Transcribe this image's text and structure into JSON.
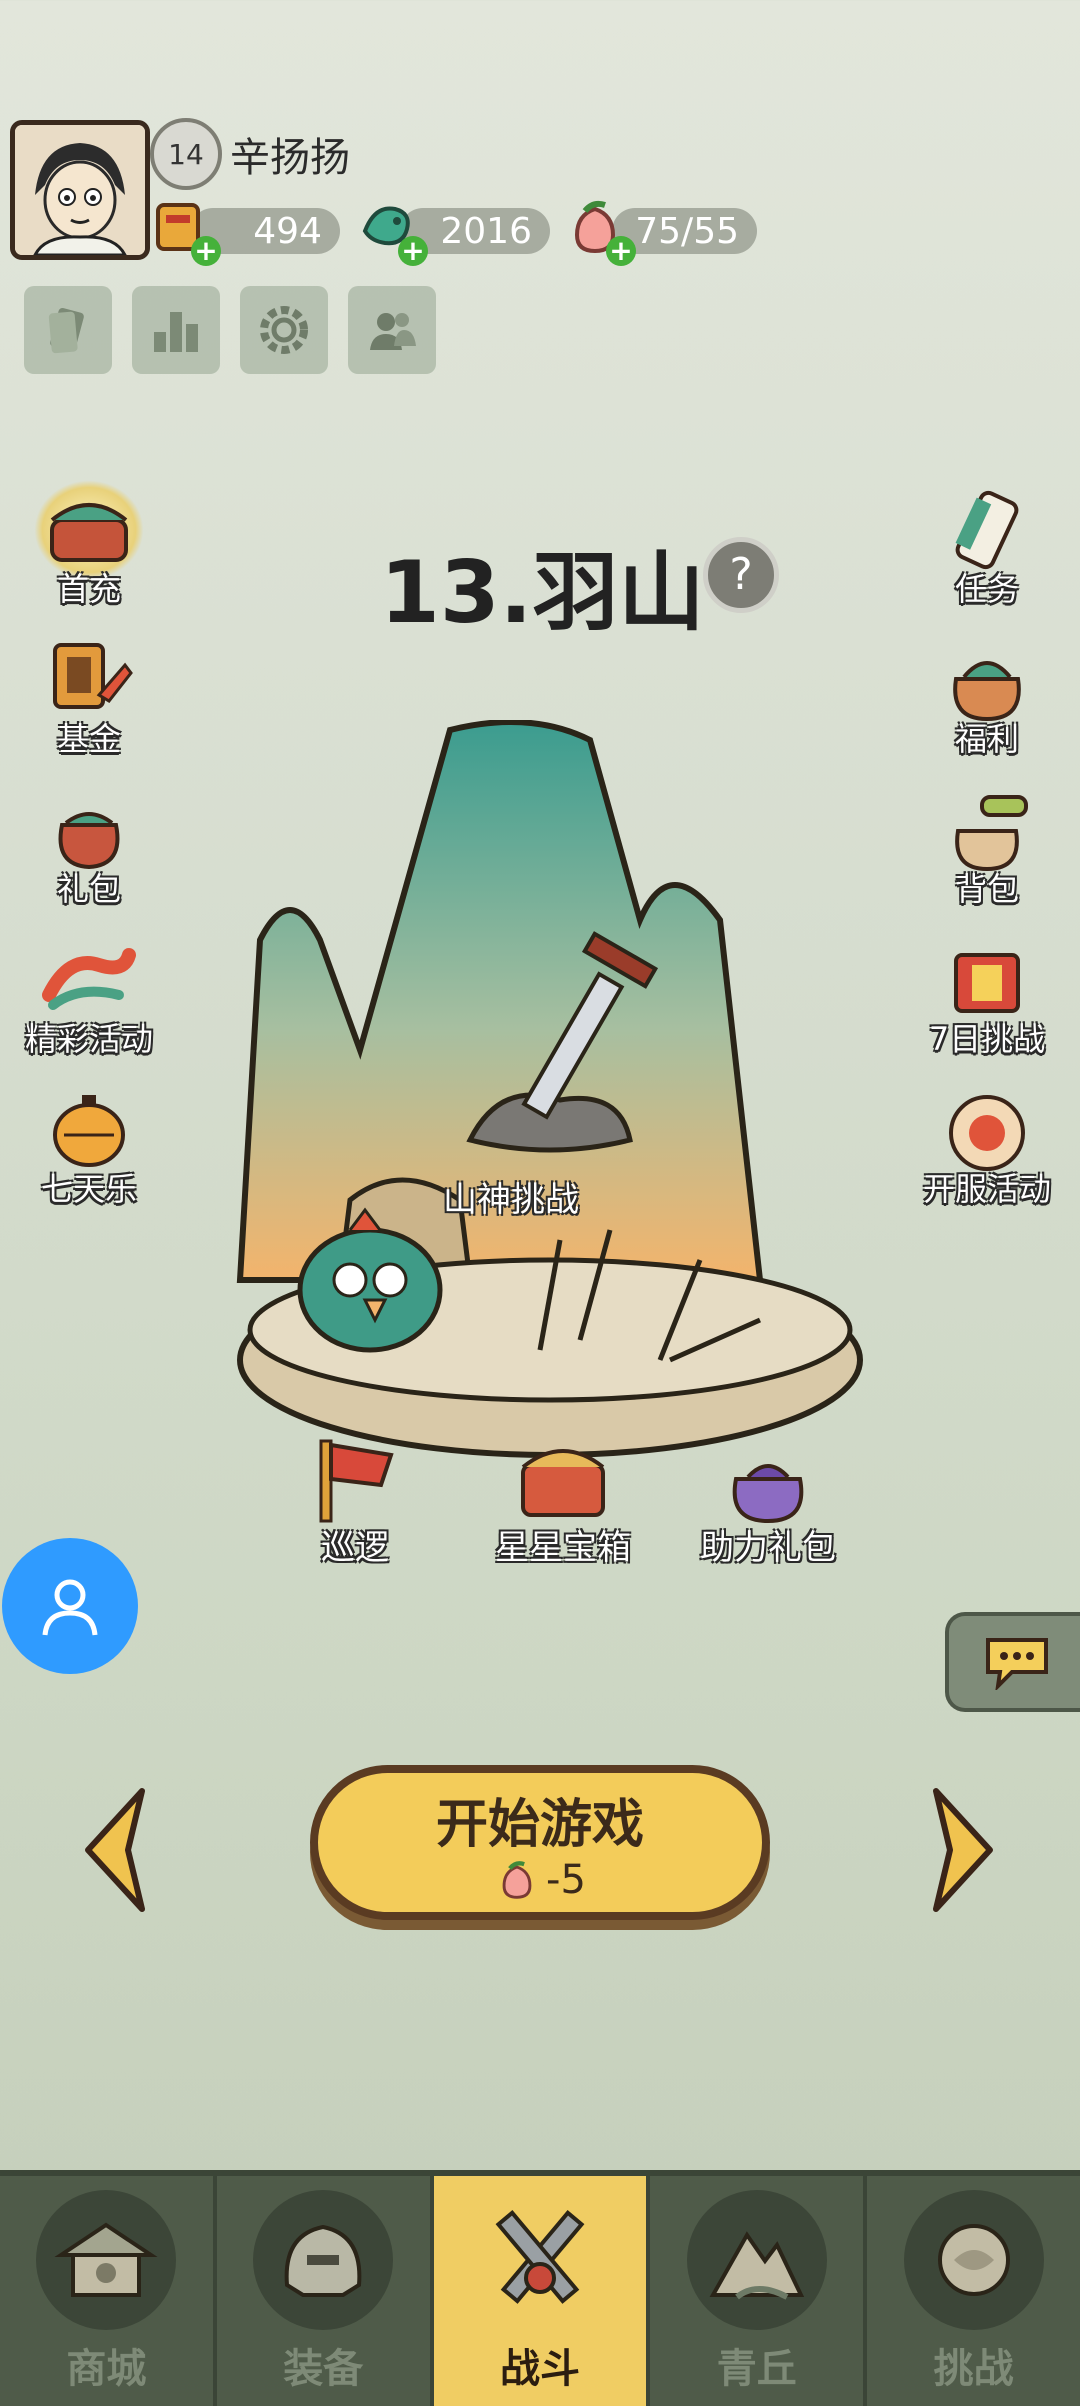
{
  "player": {
    "name": "辛扬扬",
    "level": "14"
  },
  "resources": [
    {
      "name": "gold-ticket",
      "value": "494"
    },
    {
      "name": "jade-dragon",
      "value": "2016"
    },
    {
      "name": "peach-stamina",
      "value": "75/55"
    }
  ],
  "toolbar": [
    {
      "icon": "cards-icon"
    },
    {
      "icon": "ranking-icon"
    },
    {
      "icon": "settings-gear-icon"
    },
    {
      "icon": "friends-icon"
    }
  ],
  "left_menu": [
    {
      "label": "首充"
    },
    {
      "label": "基金"
    },
    {
      "label": "礼包"
    },
    {
      "label": "精彩活动"
    },
    {
      "label": "七天乐"
    }
  ],
  "right_menu": [
    {
      "label": "任务"
    },
    {
      "label": "福利"
    },
    {
      "label": "背包"
    },
    {
      "label": "7日挑战"
    },
    {
      "label": "开服活动"
    }
  ],
  "stage": {
    "title": "13.羽山",
    "boss_label": "山神挑战",
    "features": [
      "巡逻",
      "星星宝箱",
      "助力礼包"
    ]
  },
  "start": {
    "label": "开始游戏",
    "cost": "-5"
  },
  "bottom_nav": [
    {
      "label": "商城",
      "active": false
    },
    {
      "label": "装备",
      "active": false
    },
    {
      "label": "战斗",
      "active": true
    },
    {
      "label": "青丘",
      "active": false
    },
    {
      "label": "挑战",
      "active": false
    }
  ],
  "colors": {
    "accent": "#f0cd63",
    "nav_bg": "#4f5b49",
    "plus_green": "#45b13a",
    "float_blue": "#2f9bff"
  }
}
